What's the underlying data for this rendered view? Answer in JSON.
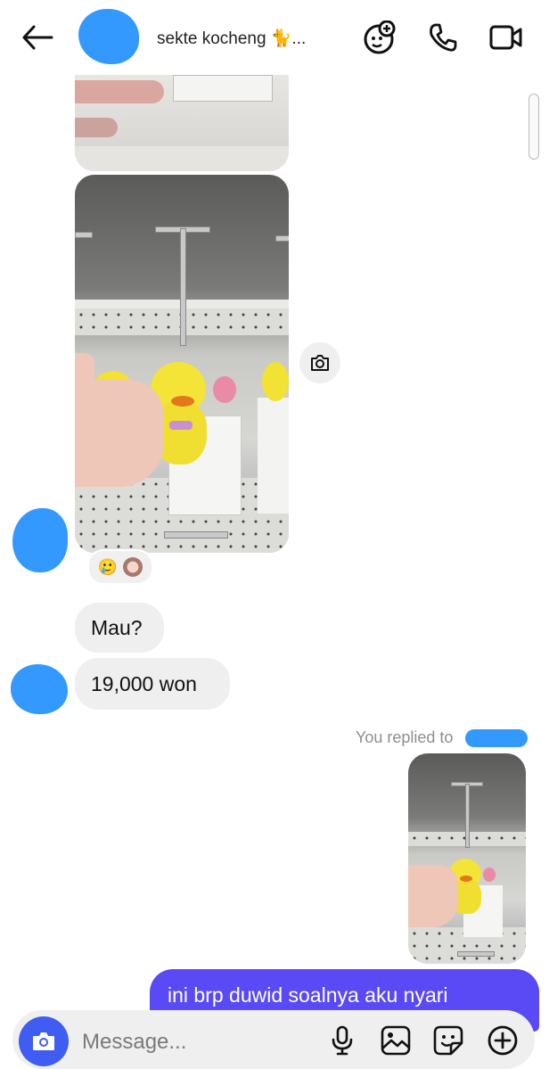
{
  "header": {
    "title": "sekte kocheng 🐈...",
    "icons": {
      "back": "arrow-left-icon",
      "effects": "sticker-add-icon",
      "call": "phone-icon",
      "video": "video-camera-icon"
    }
  },
  "messages": {
    "photo_save_icon": "camera-icon",
    "reactions": [
      "🥲"
    ],
    "bubble_1": "Mau?",
    "bubble_2": "19,000 won",
    "replied_label": "You replied to",
    "outgoing": "ini brp duwid soalnya aku nyari"
  },
  "composer": {
    "placeholder": "Message...",
    "icons": [
      "camera-icon",
      "microphone-icon",
      "gallery-icon",
      "sticker-icon",
      "plus-circle-icon"
    ]
  },
  "colors": {
    "accent": "#3f5cf3",
    "outgoing_bubble": "#5a4af6",
    "incoming_bubble": "#efefef",
    "redaction": "#3399ff"
  }
}
